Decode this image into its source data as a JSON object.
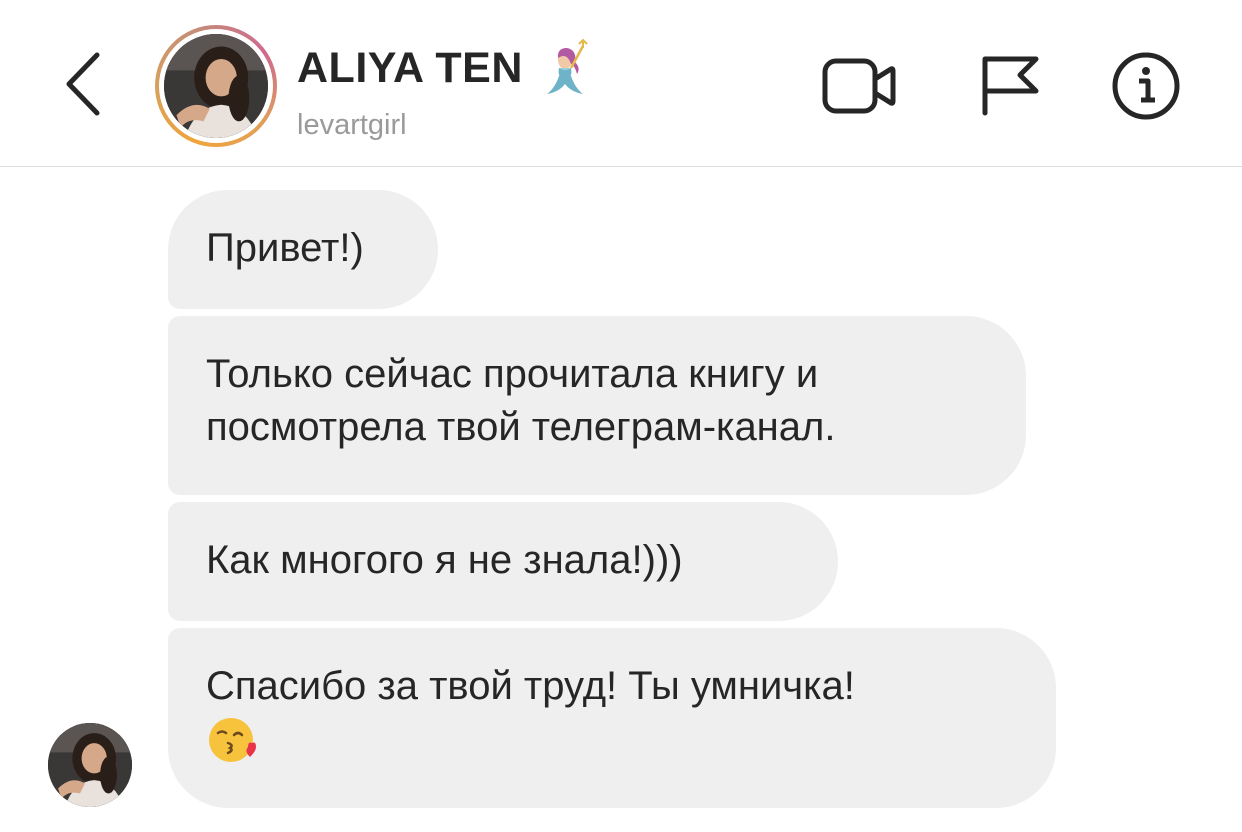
{
  "header": {
    "display_name": "ALIYA TEN",
    "username": "levartgirl",
    "icons": {
      "back": "chevron-left-icon",
      "video": "video-call-icon",
      "flag": "flag-icon",
      "info": "info-icon",
      "name_emoji": "mermaid-emoji-icon"
    }
  },
  "messages": [
    {
      "text": "Привет!)"
    },
    {
      "line1": "Только сейчас прочитала книгу и",
      "line2": "посмотрела твой телеграм-канал."
    },
    {
      "text": "Как многого я не знала!)))"
    },
    {
      "text": "Спасибо за твой труд! Ты умничка!",
      "emoji": "kissing-face-with-heart-icon"
    }
  ],
  "colors": {
    "bubble_bg": "#efefef",
    "text": "#262626",
    "username": "#9a9a9a",
    "divider": "#dcdcdc"
  }
}
